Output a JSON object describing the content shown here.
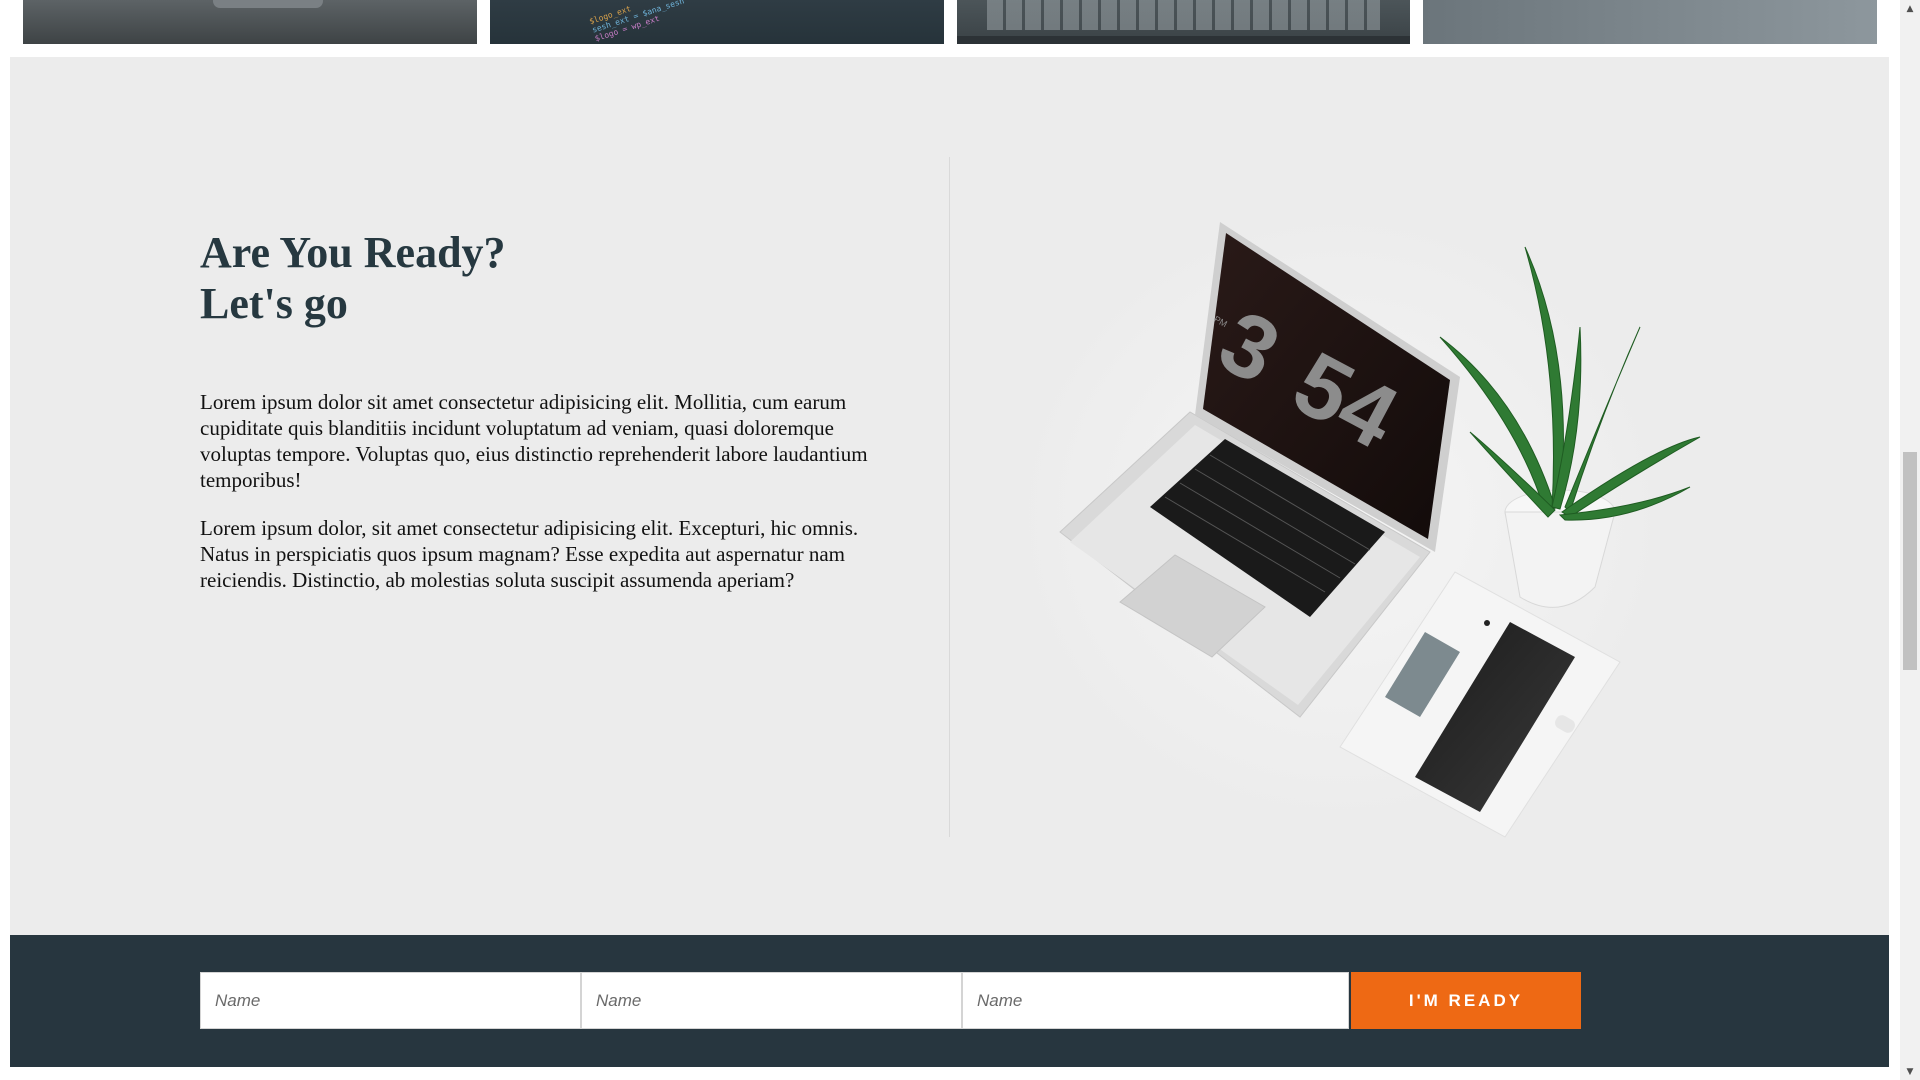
{
  "gallery": {
    "thumbnails": [
      {
        "name": "desk-photo"
      },
      {
        "name": "code-photo",
        "code_lines": [
          "$logo_ext",
          "sesh_ext = $ana_sesh",
          "$logo = wp_ext"
        ]
      },
      {
        "name": "keyboard-photo"
      },
      {
        "name": "workspace-photo"
      }
    ]
  },
  "intro": {
    "heading_line1": "Are You Ready?",
    "heading_line2": "Let's go",
    "paragraph1": "Lorem ipsum dolor sit amet consectetur adipisicing elit. Mollitia, cum earum cupiditate quis blanditiis incidunt voluptatum ad veniam, quasi doloremque voluptas tempore. Voluptas quo, eius distinctio reprehenderit labore laudantium temporibus!",
    "paragraph2": "Lorem ipsum dolor, sit amet consectetur adipisicing elit. Excepturi, hic omnis. Natus in perspiciatis quos ipsum magnam? Esse expedita aut aspernatur nam reiciendis. Distinctio, ab molestias soluta suscipit assumenda aperiam?"
  },
  "illustration": {
    "clock_hour": "3",
    "clock_minutes": "54",
    "clock_period": "PM"
  },
  "form": {
    "field1_placeholder": "Name",
    "field2_placeholder": "Name",
    "field3_placeholder": "Name",
    "submit_label": "I'M READY"
  },
  "colors": {
    "accent": "#ee6914",
    "dark": "#27363f",
    "section_bg": "#ececec",
    "heading": "#263840"
  }
}
